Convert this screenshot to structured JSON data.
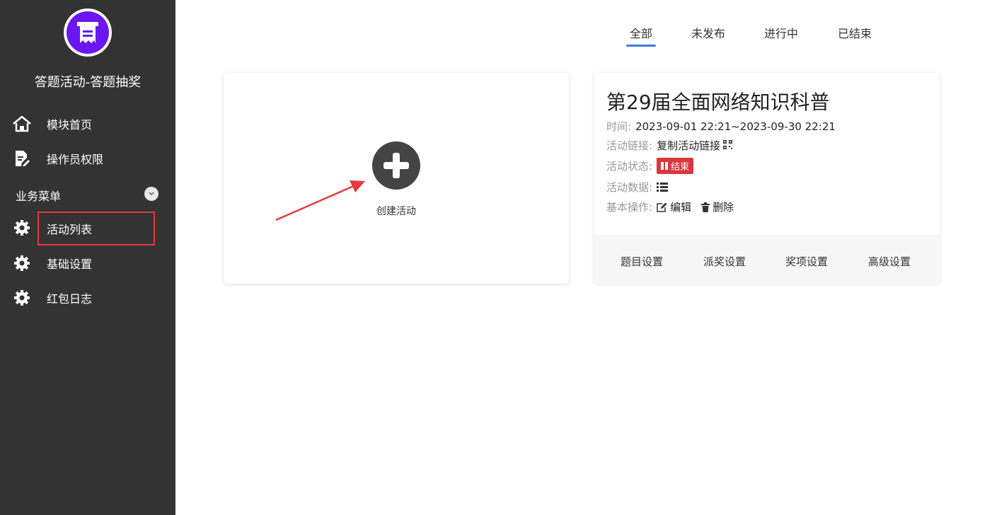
{
  "sidebar": {
    "app_title": "答题活动-答题抽奖",
    "items": [
      {
        "label": "模块首页"
      },
      {
        "label": "操作员权限"
      }
    ],
    "group_label": "业务菜单",
    "group_items": [
      {
        "label": "活动列表"
      },
      {
        "label": "基础设置"
      },
      {
        "label": "红包日志"
      }
    ]
  },
  "tabs": [
    {
      "label": "全部"
    },
    {
      "label": "未发布"
    },
    {
      "label": "进行中"
    },
    {
      "label": "已结束"
    }
  ],
  "create_card": {
    "label": "创建活动"
  },
  "activity": {
    "title": "第29届全面网络知识科普",
    "time_key": "时间:",
    "time_value": "2023-09-01 22:21~2023-09-30 22:21",
    "link_key": "活动链接:",
    "link_value": "复制活动链接",
    "status_key": "活动状态:",
    "status_value": "结束",
    "data_key": "活动数据:",
    "ops_key": "基本操作:",
    "edit_label": "编辑",
    "delete_label": "删除",
    "footer": [
      {
        "label": "题目设置"
      },
      {
        "label": "派奖设置"
      },
      {
        "label": "奖项设置"
      },
      {
        "label": "高级设置"
      }
    ]
  },
  "colors": {
    "sidebar_bg": "#333333",
    "logo_purple": "#6a16f0",
    "tab_active": "#3b7ddd",
    "status_red": "#d9363e",
    "annotation_red": "#e23b3b"
  }
}
